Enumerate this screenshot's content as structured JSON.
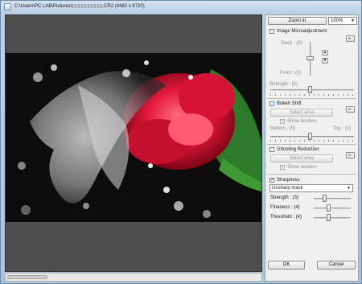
{
  "window": {
    "title_prefix": "C:\\Users\\PC LAB\\Pictures\\",
    "title_suffix": ".CR2 (4480 x 6720)"
  },
  "toolbar": {
    "zoom_in_label": "Zoom in",
    "zoom_value": "100%"
  },
  "image_microadjustment": {
    "label": "Image Microadjustment",
    "back_label": "Back : (0)",
    "front_label": "Front : (0)",
    "strength_label": "Strength : (5)",
    "checked": false
  },
  "bokeh_shift": {
    "label": "Bokeh Shift",
    "select_area_label": "Select area",
    "show_borders_label": "Show borders",
    "bottom_label": "Bottom : (0)",
    "top_label": "Top : (0)",
    "checked": false
  },
  "ghosting_reduction": {
    "label": "Ghosting Reduction",
    "select_area_label": "Select area",
    "show_borders_label": "Show borders",
    "checked": false
  },
  "sharpness": {
    "label": "Sharpness",
    "checked": true,
    "mode": "Unsharp mask",
    "strength_label": "Strength : (3)",
    "fineness_label": "Fineness : (4)",
    "threshold_label": "Threshold : (4)"
  },
  "footer": {
    "ok_label": "OK",
    "cancel_label": "Cancel"
  },
  "icons": {
    "reset": "reset-icon",
    "up": "arrow-up-icon",
    "down": "arrow-down-icon",
    "dropdown": "chevron-down-icon"
  }
}
